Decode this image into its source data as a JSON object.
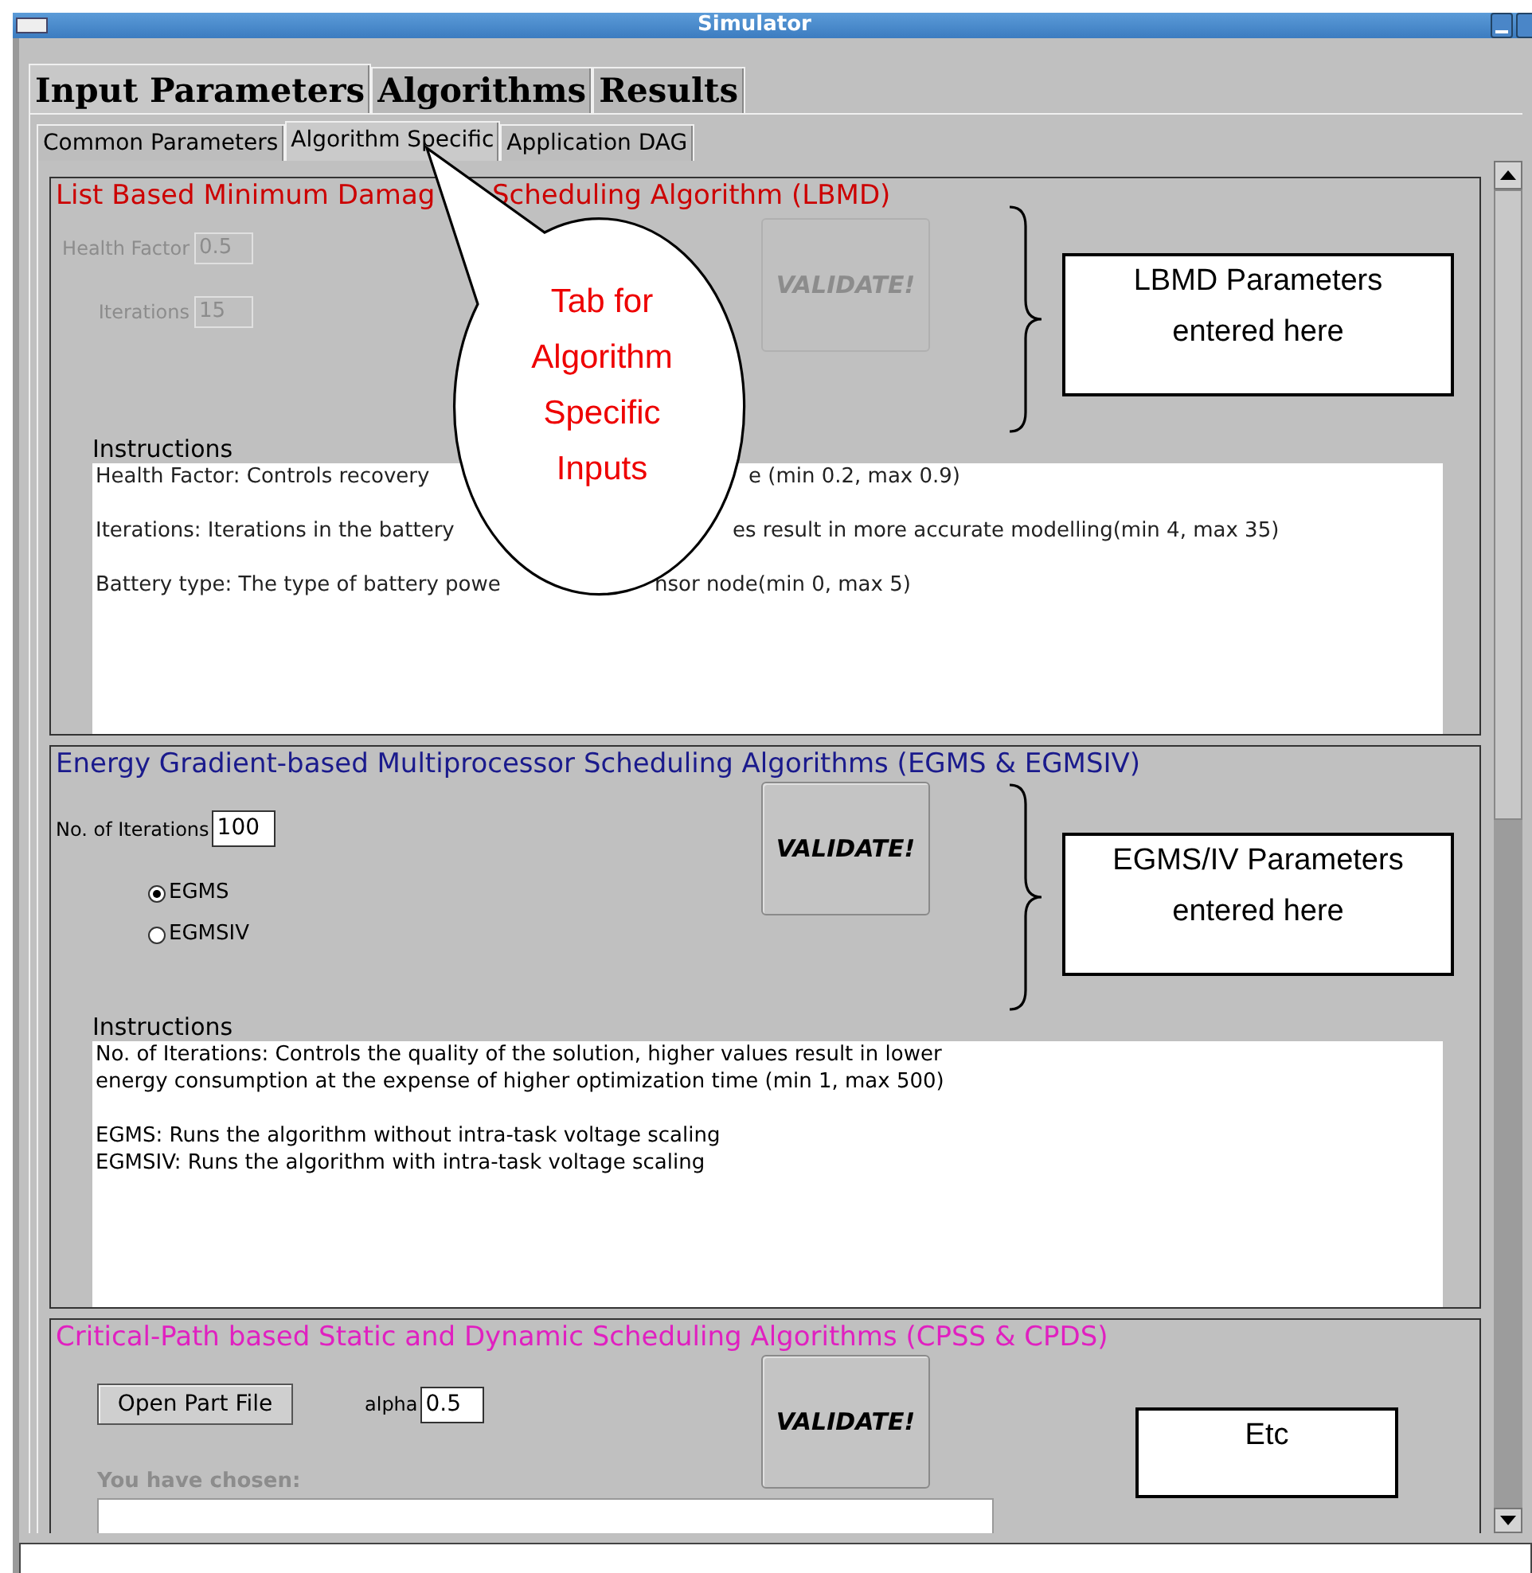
{
  "window": {
    "title": "Simulator"
  },
  "main_tabs": [
    {
      "label": "Input Parameters",
      "selected": true
    },
    {
      "label": "Algorithms",
      "selected": false
    },
    {
      "label": "Results",
      "selected": false
    }
  ],
  "sub_tabs": [
    {
      "label": "Common Parameters",
      "selected": false
    },
    {
      "label": "Algorithm Specific",
      "selected": true
    },
    {
      "label": "Application DAG",
      "selected": false
    }
  ],
  "lbmd_panel": {
    "title_parts": [
      "List Based Minimum Damag",
      "Scheduling Algorithm (LBMD)"
    ],
    "color": "#cc0000",
    "disabled": true,
    "fields": [
      {
        "label": "Health Factor",
        "value": "0.5"
      },
      {
        "label": "Iterations",
        "value": "15"
      }
    ],
    "validate_button": "VALIDATE!",
    "instructions_label": "Instructions",
    "instructions": [
      [
        "Health Factor: Controls recovery",
        "e (min 0.2, max 0.9)"
      ],
      [
        "Iterations: Iterations in the battery",
        "es result in more accurate modelling(min 4, max 35)"
      ],
      [
        "Battery type: The type of battery powe",
        "nsor node(min 0, max 5)"
      ]
    ],
    "note": "LBMD Parameters entered here"
  },
  "egms_panel": {
    "title": "Energy Gradient-based Multiprocessor Scheduling Algorithms (EGMS & EGMSIV)",
    "color": "#1a1a8c",
    "disabled": false,
    "field": {
      "label": "No. of Iterations",
      "value": "100"
    },
    "radios": [
      {
        "label": "EGMS",
        "selected": true
      },
      {
        "label": "EGMSIV",
        "selected": false
      }
    ],
    "validate_button": "VALIDATE!",
    "instructions_label": "Instructions",
    "instructions": [
      [
        "No. of Iterations: Controls the quality of the solution, higher values result in lower",
        "energy consumption at the expense of higher optimization time (min 1, max 500)"
      ],
      [
        "EGMS: Runs the algorithm without intra-task voltage scaling",
        "EGMSIV: Runs the algorithm with intra-task voltage scaling"
      ]
    ],
    "note": "EGMS/IV Parameters entered here"
  },
  "cpss_panel": {
    "title": "Critical-Path based Static and Dynamic Scheduling Algorithms (CPSS & CPDS)",
    "color": "#e020c0",
    "disabled": false,
    "open_button": "Open Part File",
    "field": {
      "label": "alpha",
      "value": "0.5"
    },
    "validate_button": "VALIDATE!",
    "chosen_label": "You have chosen:",
    "note": "Etc"
  },
  "callout": "Tab for Algorithm Specific Inputs"
}
